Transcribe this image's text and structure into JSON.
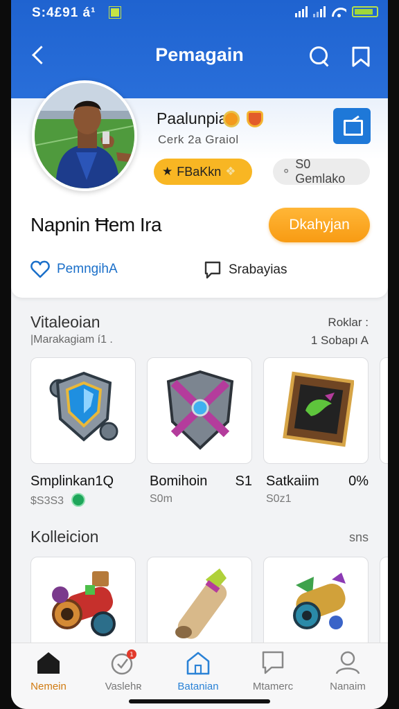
{
  "status": {
    "time": "S:4£91 á¹"
  },
  "header": {
    "title": "Pemagain"
  },
  "profile": {
    "name": "Paalunpia",
    "subtitle": "Cerk 2a Graiol",
    "rank_label": "FBaKkn",
    "gems_label": "S0 Gemlako",
    "full_name": "Napnin Ħem Ira",
    "follow_label": "Dkahyjan",
    "like_label": "PemngihA",
    "message_label": "Srabayias"
  },
  "section1": {
    "title": "Vitaleoian",
    "subtitle": "|Marakagiam í1 .",
    "more": "Roklar :",
    "count": "1 Sobapı A",
    "items": [
      {
        "name": "Smplinkan1Q",
        "value": "",
        "sub": "$S3S3"
      },
      {
        "name": "Bomihoin",
        "value": "S1",
        "sub": "S0m"
      },
      {
        "name": "Satkaiim",
        "value": "0%",
        "sub": "S0z1"
      }
    ]
  },
  "section2": {
    "title": "Kolleicion",
    "more": "sns"
  },
  "bottom_nav": [
    {
      "label": "Nemein",
      "active": true
    },
    {
      "label": "Vaslehʀ",
      "badge": "1"
    },
    {
      "label": "Batanian"
    },
    {
      "label": "Mtamerc"
    },
    {
      "label": "Nanaim"
    }
  ],
  "colors": {
    "header": "#1f63d0",
    "accent_orange": "#f8a81c",
    "link_blue": "#1a6fc9"
  }
}
